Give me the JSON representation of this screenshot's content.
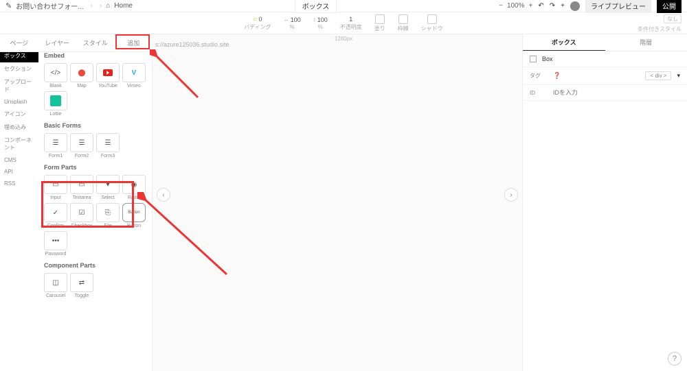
{
  "breadcrumb": {
    "project": "お問い合わせフォー...",
    "page": "Home",
    "pencil": "✎",
    "sep": "›"
  },
  "topTab": "ボックス",
  "zoom": {
    "minus": "−",
    "value": "100%",
    "plus": "+"
  },
  "toolbar": {
    "undo": "↶",
    "redo": "↷",
    "addUser": "+",
    "preview": "ライブプレビュー",
    "publish": "公開"
  },
  "propbar": {
    "padding": {
      "icon": "▭",
      "value": "0",
      "label": "パディング"
    },
    "width": {
      "arrow": "↔",
      "value": "100",
      "unit": "%"
    },
    "height": {
      "arrow": "↕",
      "value": "100",
      "unit": "%"
    },
    "opacity": {
      "value": "1",
      "label": "不透明度"
    },
    "fill": {
      "label": "塗り"
    },
    "border": {
      "label": "枠線"
    },
    "shadow": {
      "label": "シャドウ"
    },
    "none": "なし",
    "cond": "条件付きスタイル"
  },
  "ruler": "1280px",
  "url": "s://azure125036.studio.site",
  "tabs": {
    "page": "ページ",
    "layer": "レイヤー",
    "style": "スタイル",
    "add": "追加"
  },
  "cats": [
    "ボックス",
    "セクション",
    "アップロード",
    "Unsplash",
    "アイコン",
    "埋め込み",
    "コンポーネント",
    "CMS",
    "API",
    "RSS"
  ],
  "sections": {
    "embed": {
      "title": "Embed",
      "items": [
        {
          "icon": "</>",
          "label": "Blank"
        },
        {
          "icon": "📍",
          "label": "Map"
        },
        {
          "icon": "yt",
          "label": "YouTube"
        },
        {
          "icon": "V",
          "label": "Vimeo"
        },
        {
          "icon": "lottie",
          "label": "Lottie"
        }
      ]
    },
    "forms": {
      "title": "Basic Forms",
      "items": [
        {
          "icon": "form",
          "label": "Form1"
        },
        {
          "icon": "form",
          "label": "Form2"
        },
        {
          "icon": "form",
          "label": "Form3"
        }
      ]
    },
    "parts": {
      "title": "Form Parts",
      "items": [
        {
          "icon": "▭",
          "label": "Input"
        },
        {
          "icon": "T",
          "label": "Textarea"
        },
        {
          "icon": "▾",
          "label": "Select"
        },
        {
          "icon": "◉",
          "label": "Radio"
        },
        {
          "icon": "✓",
          "label": "Confirm"
        },
        {
          "icon": "☑",
          "label": "Checkbox"
        },
        {
          "icon": "📎",
          "label": "File"
        },
        {
          "icon": "Button",
          "label": "Button"
        },
        {
          "icon": "•••",
          "label": "Password"
        }
      ]
    },
    "comp": {
      "title": "Component Parts",
      "items": [
        {
          "icon": "◫",
          "label": "Carousel"
        },
        {
          "icon": "⇄",
          "label": "Toggle"
        }
      ]
    }
  },
  "nav": {
    "prev": "‹",
    "next": "›"
  },
  "right": {
    "tabs": {
      "box": "ボックス",
      "layer": "階層"
    },
    "boxCheck": "Box",
    "tag": {
      "label": "タグ",
      "icon": "❓",
      "value": "< div >",
      "caret": "▾"
    },
    "id": {
      "label": "ID",
      "placeholder": "IDを入力"
    }
  },
  "help": "?"
}
